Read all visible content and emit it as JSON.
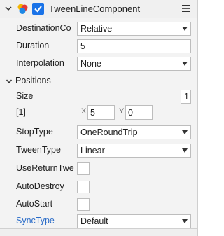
{
  "header": {
    "title": "TweenLineComponent",
    "enabled": true
  },
  "fields": {
    "destination_label": "DestinationCo",
    "destination_value": "Relative",
    "duration_label": "Duration",
    "duration_value": "5",
    "interpolation_label": "Interpolation",
    "interpolation_value": "None",
    "positions_label": "Positions",
    "size_label": "Size",
    "size_value": "1",
    "item_label": "[1]",
    "x_label": "X",
    "x_value": "5",
    "y_label": "Y",
    "y_value": "0",
    "stoptype_label": "StopType",
    "stoptype_value": "OneRoundTrip",
    "tweentype_label": "TweenType",
    "tweentype_value": "Linear",
    "usereturn_label": "UseReturnTwe",
    "autodestroy_label": "AutoDestroy",
    "autostart_label": "AutoStart",
    "synctype_label": "SyncType",
    "synctype_value": "Default"
  },
  "colors": {
    "checkbox_accent": "#1a73e8",
    "link_label": "#2a6cc8"
  }
}
